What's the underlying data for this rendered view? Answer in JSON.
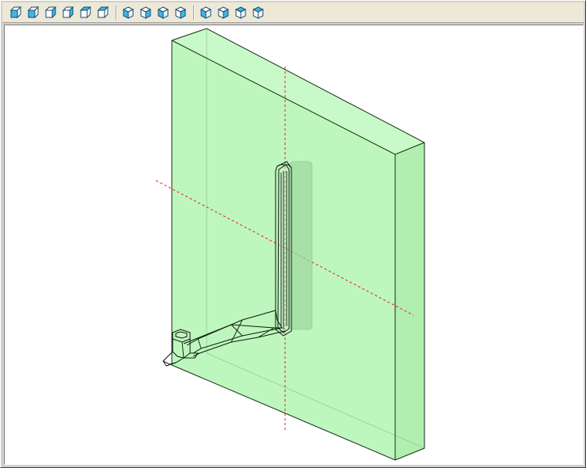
{
  "toolbar": {
    "groups": [
      [
        "view-front-icon",
        "view-back-icon",
        "view-left-icon",
        "view-right-icon",
        "view-top-icon",
        "view-bottom-icon"
      ],
      [
        "iso-front-left-icon",
        "iso-front-right-icon",
        "iso-back-left-icon",
        "iso-back-right-icon"
      ],
      [
        "iso-bottom-front-left-icon",
        "iso-bottom-front-right-icon",
        "iso-bottom-back-left-icon",
        "iso-bottom-back-right-icon"
      ]
    ]
  },
  "colors": {
    "plate_fill": "#b4f5b4",
    "plate_side": "#a8eca8",
    "plate_top": "#c6f8c6",
    "edge": "#1a2a1a",
    "axis": "#e02020",
    "icon_face": "#3fb6e8",
    "icon_edge": "#1a4a6a"
  }
}
